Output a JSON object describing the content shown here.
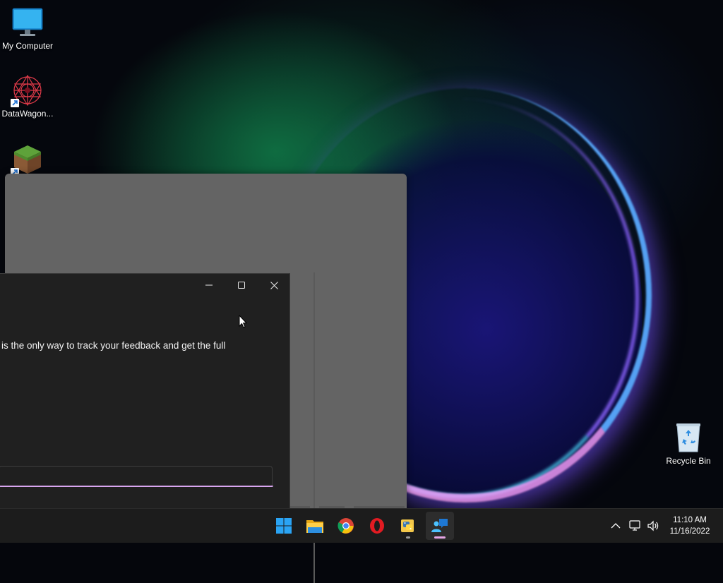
{
  "desktop": {
    "icons": [
      {
        "label": "My Computer",
        "icon": "monitor-icon"
      },
      {
        "label": "DataWagon...",
        "icon": "datawagon-icon"
      },
      {
        "label": "",
        "icon": "minecraft-grass-block-icon"
      },
      {
        "label": "Recycle Bin",
        "icon": "recycle-bin-icon"
      }
    ]
  },
  "dialog": {
    "body_text": "is the only way to track your feedback and get the full",
    "input": {
      "value": "",
      "placeholder": ""
    },
    "accent_color": "#d9a6f0"
  },
  "taskbar": {
    "apps": [
      {
        "name": "start-button",
        "icon": "windows-logo-icon"
      },
      {
        "name": "file-explorer",
        "icon": "folder-icon"
      },
      {
        "name": "chrome",
        "icon": "chrome-icon"
      },
      {
        "name": "opera",
        "icon": "opera-icon"
      },
      {
        "name": "python-idle",
        "icon": "python-folder-icon"
      },
      {
        "name": "feedback-hub",
        "icon": "feedback-hub-icon"
      }
    ],
    "clock": {
      "time": "11:10 AM",
      "date": "11/16/2022"
    }
  }
}
